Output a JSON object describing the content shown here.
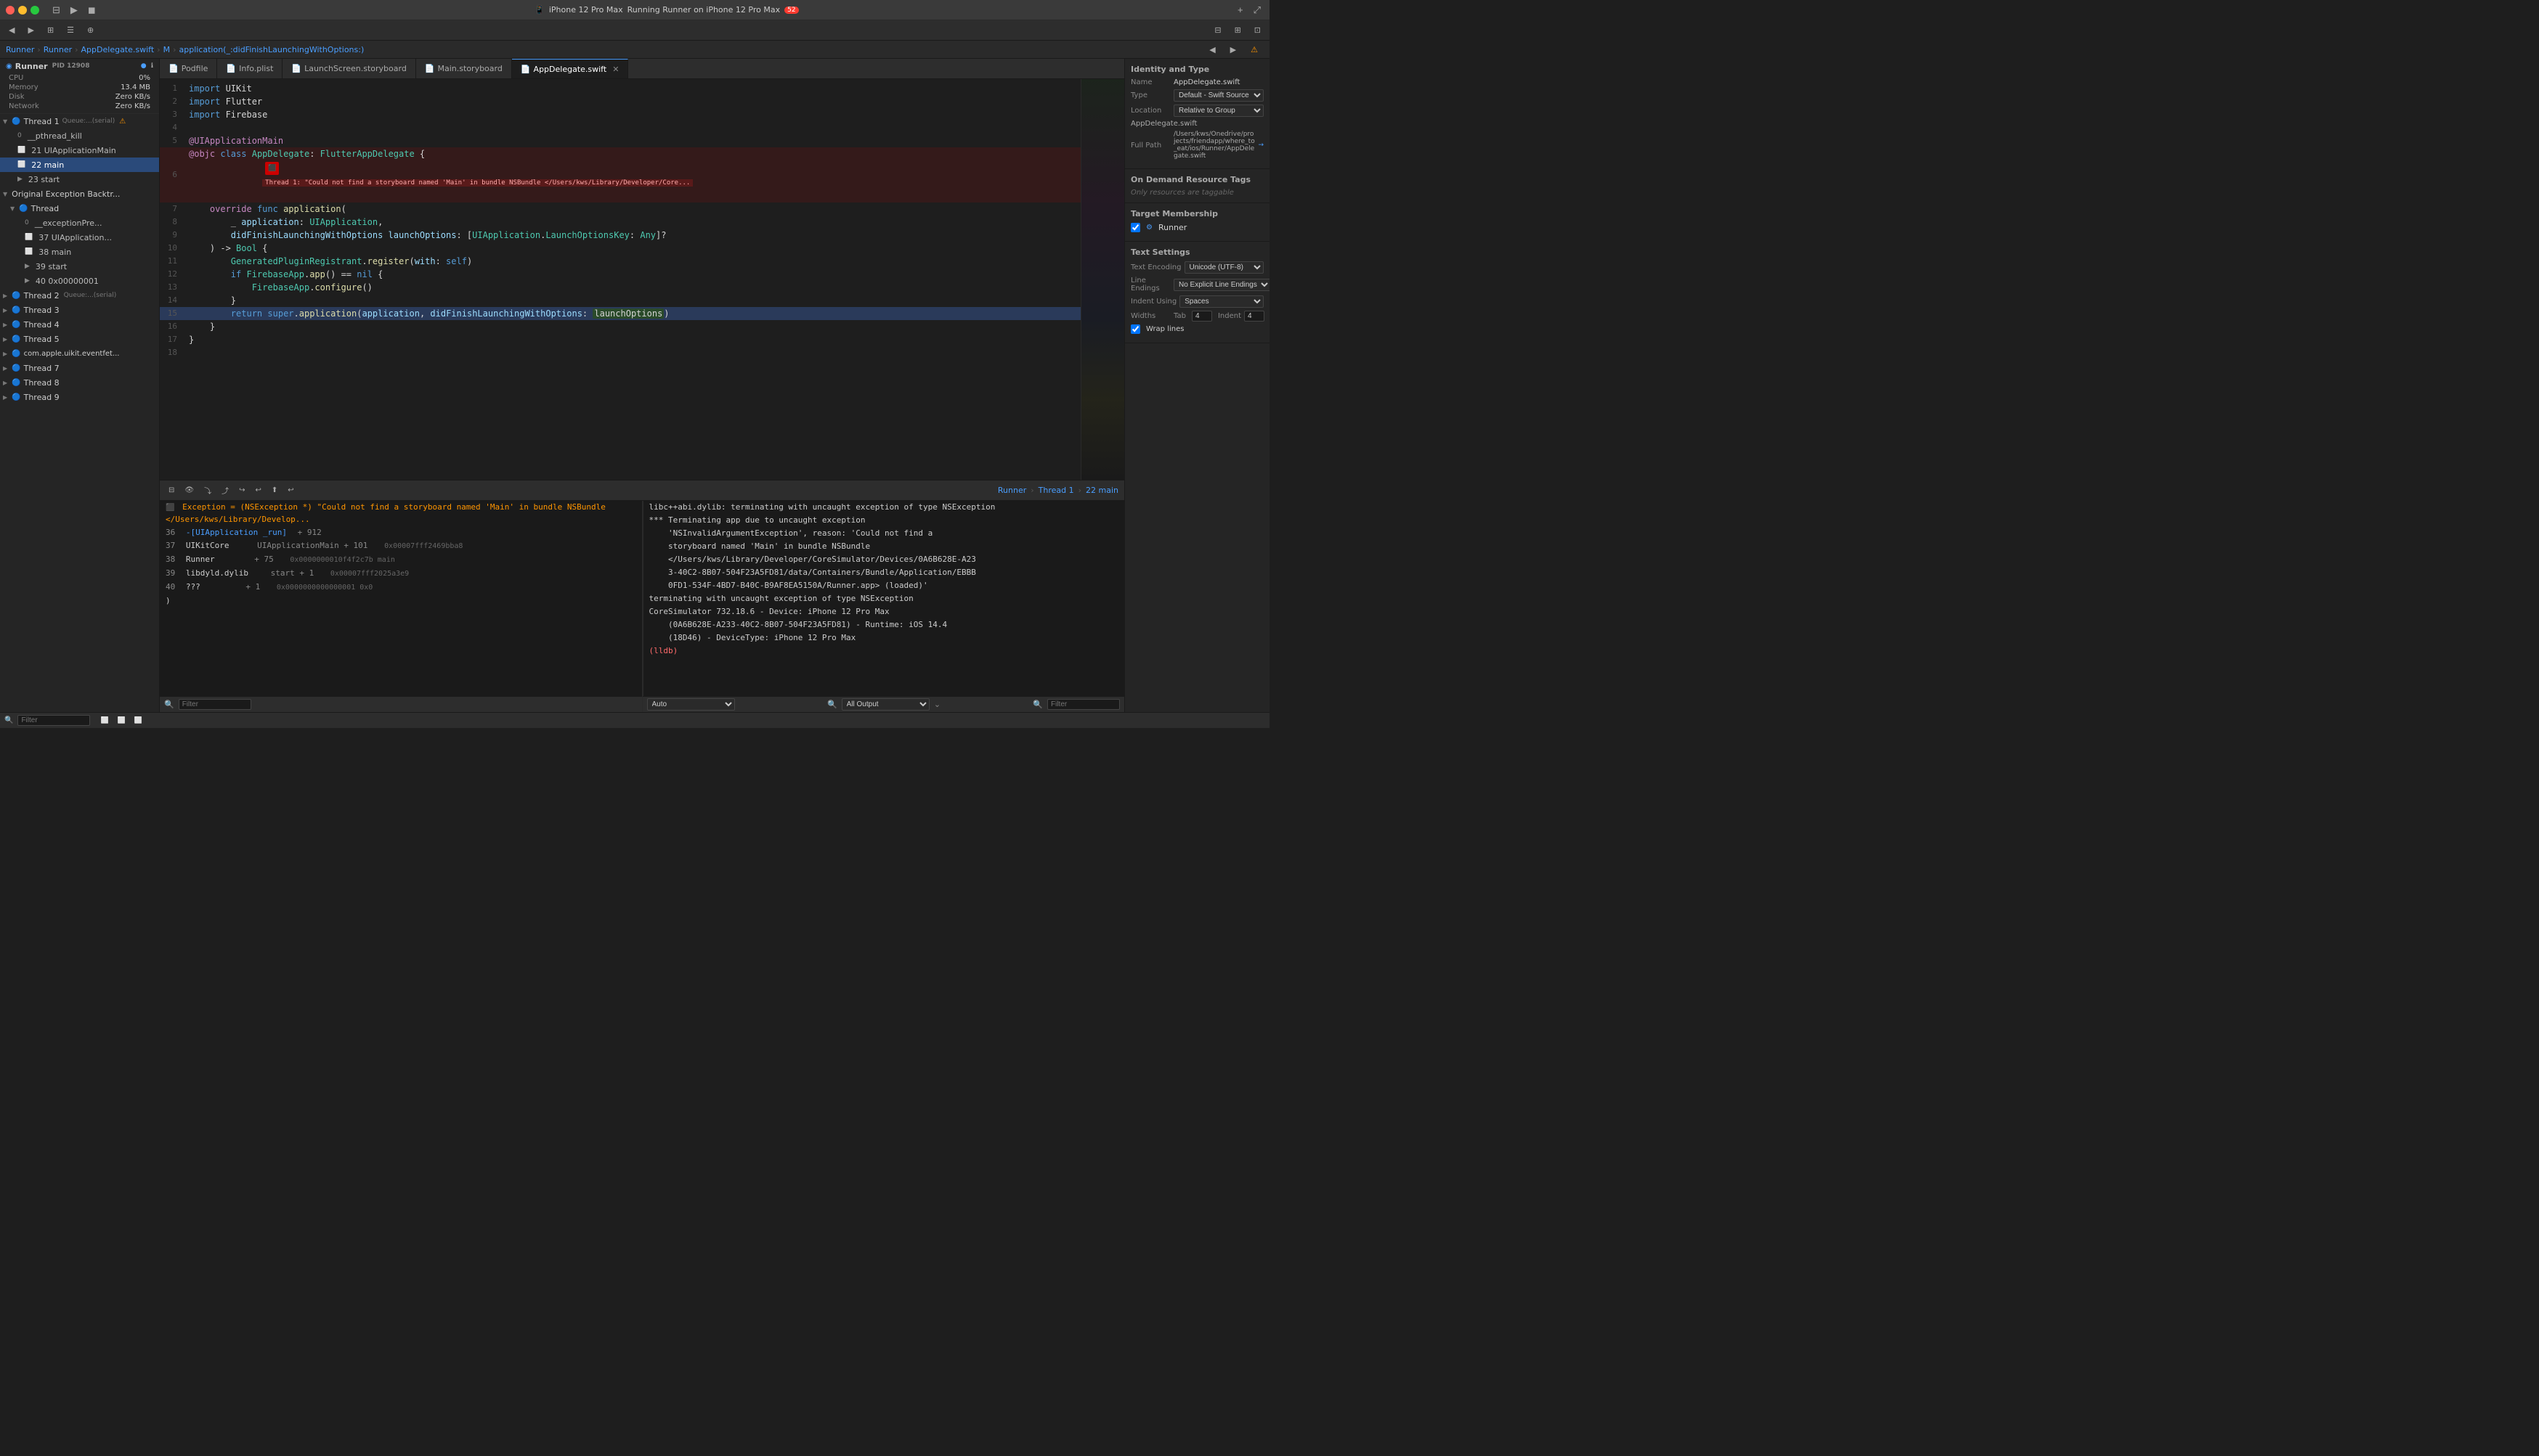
{
  "titlebar": {
    "run_label": "▶",
    "stop_label": "◼",
    "device": "iPhone 12 Pro Max",
    "status": "Running Runner on iPhone 12 Pro Max",
    "warnings": "52"
  },
  "toolbar_tabs": [
    "Podfile",
    "Info.plist",
    "LaunchScreen.storyboard",
    "Main.storyboard",
    "AppDelegate.swift"
  ],
  "breadcrumb": [
    "Runner",
    "Runner",
    "AppDelegate.swift",
    "M",
    "application(_:didFinishLaunchingWithOptions:)"
  ],
  "sidebar": {
    "runner_label": "Runner",
    "pid": "PID 12908",
    "metrics": [
      {
        "name": "CPU",
        "value": "0%"
      },
      {
        "name": "Memory",
        "value": "13.4 MB"
      },
      {
        "name": "Disk",
        "value": "Zero KB/s"
      },
      {
        "name": "Network",
        "value": "Zero KB/s"
      }
    ],
    "threads": [
      {
        "id": "thread1",
        "label": "Thread 1",
        "sublabel": "Queue:...(serial)",
        "warning": true,
        "expanded": true,
        "children": [
          {
            "label": "0 __pthread_kill",
            "frame": "0"
          },
          {
            "label": "21 UIApplicationMain",
            "frame": "21"
          },
          {
            "label": "22 main",
            "frame": "22",
            "selected": true
          },
          {
            "label": "23 start",
            "frame": "23"
          }
        ]
      },
      {
        "id": "original",
        "label": "Original Exception Backtr...",
        "expanded": true,
        "children": [
          {
            "label": "Thread",
            "expanded": true,
            "children": [
              {
                "label": "0 __exceptionPre...",
                "frame": "0"
              },
              {
                "label": "37 UIApplication...",
                "frame": "37"
              },
              {
                "label": "38 main",
                "frame": "38"
              },
              {
                "label": "39 start",
                "frame": "39"
              },
              {
                "label": "40 0x00000001",
                "frame": "40"
              }
            ]
          }
        ]
      },
      {
        "id": "thread2",
        "label": "Thread 2",
        "sublabel": "Queue:...(serial)"
      },
      {
        "id": "thread3",
        "label": "Thread 3"
      },
      {
        "id": "thread4",
        "label": "Thread 4"
      },
      {
        "id": "thread5",
        "label": "Thread 5"
      },
      {
        "id": "thread6",
        "label": "com.apple.uikit.eventfet..."
      },
      {
        "id": "thread7",
        "label": "Thread 7"
      },
      {
        "id": "thread8",
        "label": "Thread 8"
      },
      {
        "id": "thread9",
        "label": "Thread 9"
      }
    ]
  },
  "editor": {
    "filename": "AppDelegate.swift",
    "lines": [
      {
        "num": 1,
        "code": "import UIKit",
        "tokens": [
          {
            "t": "kw",
            "v": "import"
          },
          {
            "t": "text",
            "v": " UIKit"
          }
        ]
      },
      {
        "num": 2,
        "code": "import Flutter",
        "tokens": [
          {
            "t": "kw",
            "v": "import"
          },
          {
            "t": "text",
            "v": " Flutter"
          }
        ]
      },
      {
        "num": 3,
        "code": "import Firebase",
        "tokens": [
          {
            "t": "kw",
            "v": "import"
          },
          {
            "t": "text",
            "v": " Firebase"
          }
        ]
      },
      {
        "num": 4,
        "code": ""
      },
      {
        "num": 5,
        "code": "@UIApplicationMain"
      },
      {
        "num": 6,
        "code": "@objc class AppDelegate: FlutterAppDelegate {",
        "error": true
      },
      {
        "num": 7,
        "code": "    override func application("
      },
      {
        "num": 8,
        "code": "        _ application: UIApplication,"
      },
      {
        "num": 9,
        "code": "        didFinishLaunchingWithOptions launchOptions: [UIApplication.LaunchOptionsKey: Any]?"
      },
      {
        "num": 10,
        "code": "    ) -> Bool {"
      },
      {
        "num": 11,
        "code": "        GeneratedPluginRegistrant.register(with: self)"
      },
      {
        "num": 12,
        "code": "        if FirebaseApp.app() == nil {"
      },
      {
        "num": 13,
        "code": "            FirebaseApp.configure()"
      },
      {
        "num": 14,
        "code": "        }"
      },
      {
        "num": 15,
        "code": "        return super.application(application, didFinishLaunchingWithOptions: launchOptions)",
        "current": true
      },
      {
        "num": 16,
        "code": "    }"
      },
      {
        "num": 17,
        "code": "}"
      },
      {
        "num": 18,
        "code": ""
      }
    ],
    "error_banner": "Thread 1: \"Could not find a storyboard named 'Main' in bundle NSBundle </Users/kws/Library/Developer/Core..."
  },
  "right_panel": {
    "identity_type": {
      "title": "Identity and Type",
      "name_label": "Name",
      "name_value": "AppDelegate.swift",
      "type_label": "Type",
      "type_value": "Default - Swift Source",
      "location_label": "Location",
      "location_value": "Relative to Group",
      "location_path": "AppDelegate.swift",
      "full_path_label": "Full Path",
      "full_path_value": "/Users/kws/Onedrive/projects/friendapp/where_to_eat/ios/Runner/AppDelegate.swift"
    },
    "on_demand": {
      "title": "On Demand Resource Tags",
      "placeholder": "Only resources are taggable"
    },
    "target_membership": {
      "title": "Target Membership",
      "runner": "Runner"
    },
    "text_settings": {
      "title": "Text Settings",
      "encoding_label": "Text Encoding",
      "encoding_value": "Unicode (UTF-8)",
      "line_endings_label": "Line Endings",
      "line_endings_value": "No Explicit Line Endings",
      "indent_label": "Indent Using",
      "indent_value": "Spaces",
      "tab_label": "Tab",
      "tab_value": "4",
      "indent_num_label": "Indent",
      "indent_num_value": "4",
      "wrap_label": "Wrap lines",
      "wrap_checked": true
    }
  },
  "bottom": {
    "debug": {
      "toolbar": [
        "▼",
        "▶",
        "⏸",
        "⤵",
        "⤴",
        "↪",
        "▲",
        "↩"
      ],
      "breadcrumb": [
        "Runner",
        "Thread 1",
        "22 main"
      ],
      "exception_line": "Exception = (NSException *) \"Could not find a storyboard named 'Main' in bundle NSBundle </Users/kws/Library/Develop...",
      "stack_frames": [
        {
          "num": "36",
          "fn": "-[UIApplication _run]",
          "offset": "+ 912",
          "addr": ""
        },
        {
          "num": "37",
          "fn": "UIKitCore",
          "sub": "UIApplicationMain + 101",
          "addr": "0x00007fff2469bba8"
        },
        {
          "num": "38",
          "fn": "Runner",
          "sub": "+ 75",
          "addr": "0x0000000010f4f2c7b main"
        },
        {
          "num": "39",
          "fn": "libdyld.dylib",
          "sub": "start + 1",
          "addr": "0x00007fff2025a3e9"
        },
        {
          "num": "40",
          "fn": "???",
          "sub": "+ 1",
          "addr": "0x0000000000000001 0x0"
        }
      ]
    },
    "output": {
      "lines": [
        "libc++abi.dylib: terminating with uncaught exception of type NSException",
        "*** Terminating app due to uncaught exception 'NSInvalidArgumentException', reason: 'Could not find a storyboard named 'Main' in bundle NSBundle </Users/kws/Library/Developer/CoreSimulator/Devices/0A6B628E-A23-40C2-8B07-504F23A5FD81/data/Containers/Bundle/Application/EBBB0FD1-534F-4BD7-B40C-B9AF8EA5150A/Runner.app> (loaded)' terminating with uncaught exception of type NSException",
        "CoreSimulator 732.18.6 - Device: iPhone 12 Pro Max (0A6B628E-A233-40C2-8B07-504F23A5FD81) - Runtime: iOS 14.4 (18D46) - DeviceType: iPhone 12 Pro Max",
        "(lldb)"
      ]
    }
  },
  "statusbar": {
    "filter_label": "Filter",
    "output_label": "All Output",
    "auto": "Auto"
  }
}
